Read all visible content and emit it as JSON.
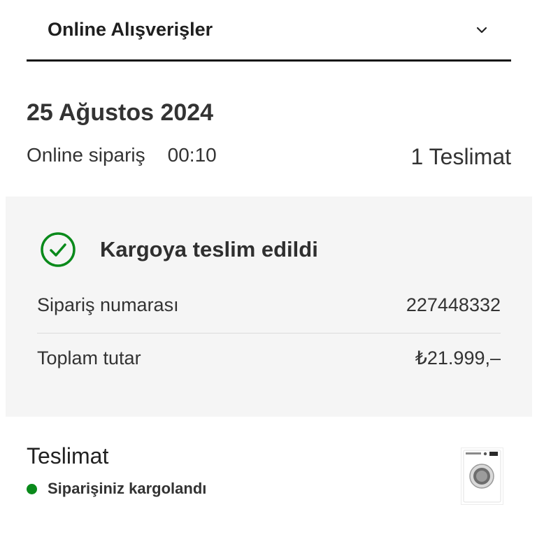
{
  "accordion": {
    "title": "Online Alışverişler"
  },
  "order": {
    "date": "25 Ağustos 2024",
    "type": "Online sipariş",
    "time": "00:10",
    "delivery_count": "1 Teslimat"
  },
  "status_panel": {
    "status": "Kargoya teslim edildi",
    "rows": [
      {
        "label": "Sipariş numarası",
        "value": "227448332"
      },
      {
        "label": "Toplam tutar",
        "value": "₺21.999,–"
      }
    ]
  },
  "delivery": {
    "title": "Teslimat",
    "status": "Siparişiniz kargolandı"
  },
  "colors": {
    "accent_green": "#0a8a1b",
    "panel_bg": "#f5f5f5",
    "header_rule": "#111111"
  },
  "icons": {
    "chevron": "chevron-down-icon",
    "status": "check-circle-icon",
    "product": "washing-machine-thumbnail"
  }
}
